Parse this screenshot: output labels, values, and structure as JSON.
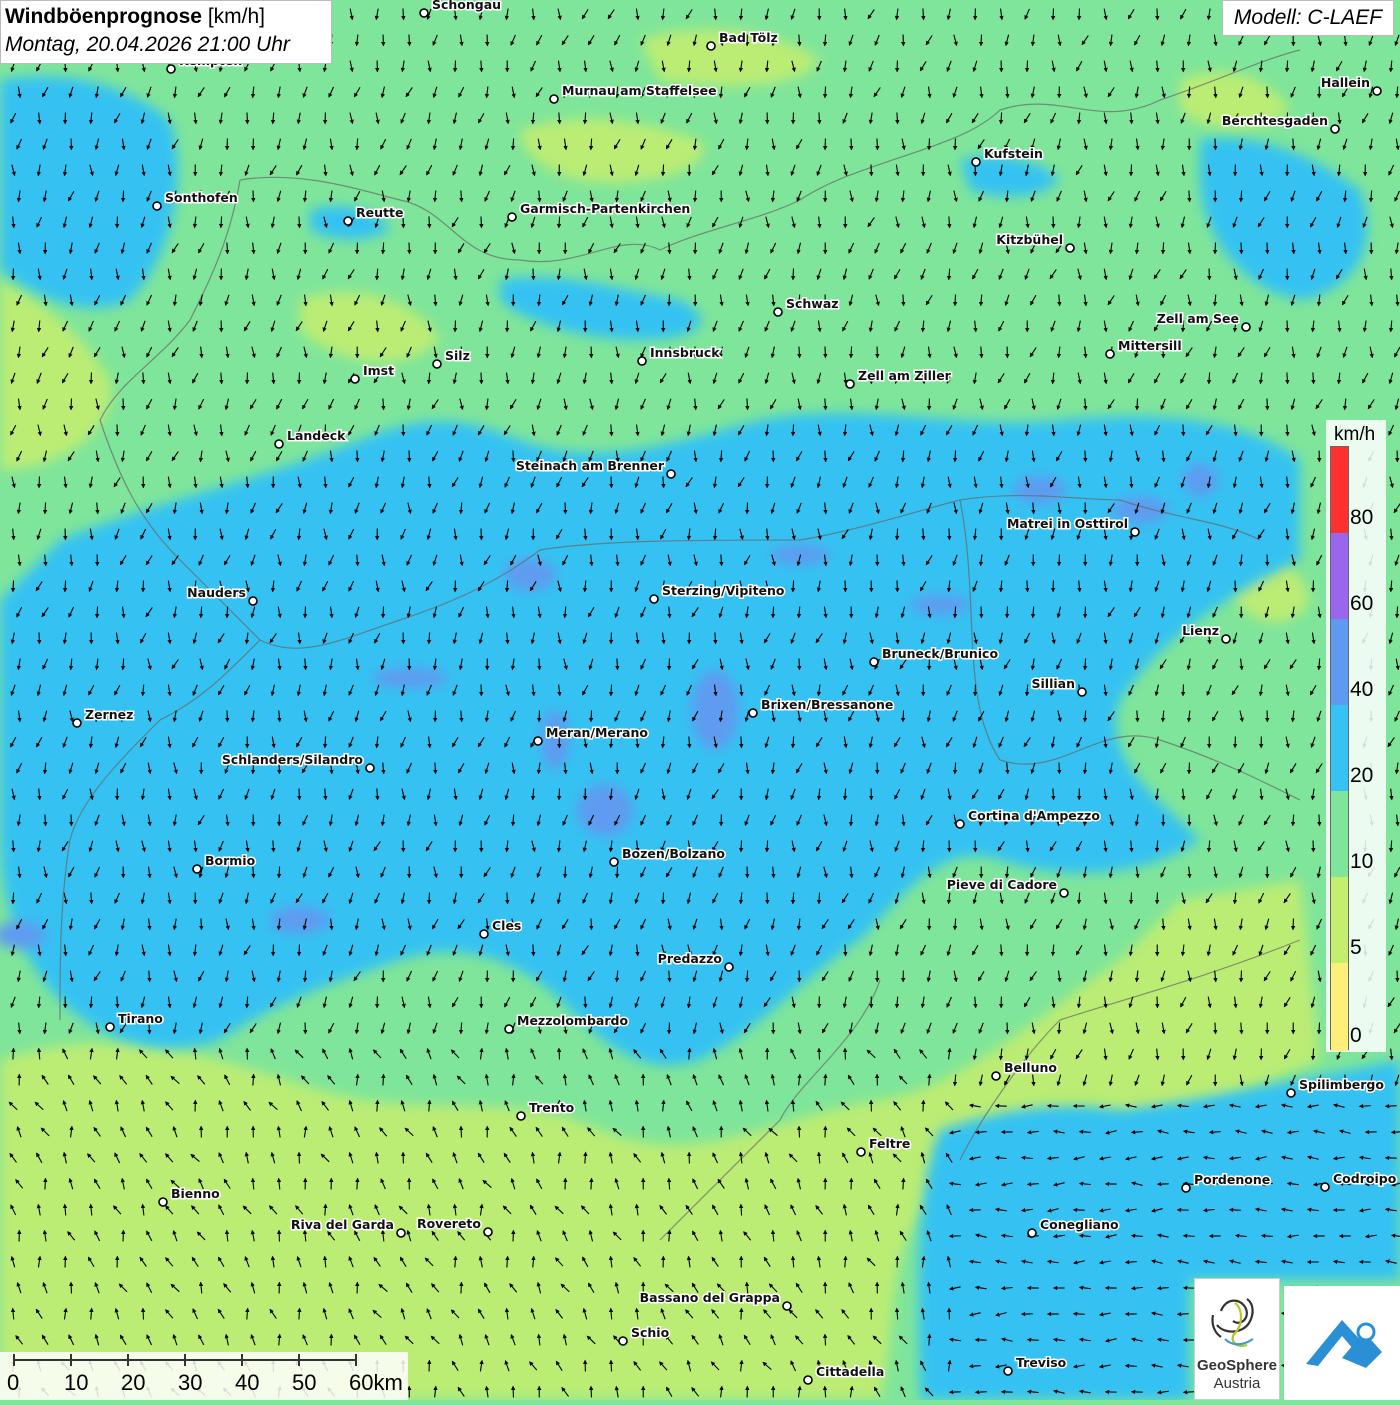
{
  "header": {
    "title_bold": "Windböenprognose",
    "title_unit": "[km/h]",
    "datetime": "Montag, 20.04.2026 21:00 Uhr",
    "model": "Modell: C-LAEF"
  },
  "legend": {
    "unit": "km/h",
    "ticks": [
      "80",
      "60",
      "40",
      "20",
      "10",
      "5",
      "0"
    ],
    "colors": [
      "#ff3030",
      "#9b66ee",
      "#5e9bf0",
      "#36c2f2",
      "#7fe59a",
      "#c6ee6e",
      "#fcf07a"
    ]
  },
  "scale": {
    "ticks": [
      "0",
      "10",
      "20",
      "30",
      "40",
      "50",
      "60km"
    ]
  },
  "logos": {
    "geosphere_line1": "GeoSphere",
    "geosphere_line2": "Austria",
    "geosphere_icon": "geosphere-swirl-icon",
    "app_icon": "mountain-cloud-icon"
  },
  "cities": [
    {
      "name": "Schongau",
      "side": "right"
    },
    {
      "name": "Bad Tölz",
      "side": "right"
    },
    {
      "name": "Kempten",
      "side": "right"
    },
    {
      "name": "Murnau am Staffelsee",
      "side": "right"
    },
    {
      "name": "Hallein",
      "side": "left"
    },
    {
      "name": "Berchtesgaden",
      "side": "left"
    },
    {
      "name": "Kufstein",
      "side": "right"
    },
    {
      "name": "Sonthofen",
      "side": "right"
    },
    {
      "name": "Reutte",
      "side": "right"
    },
    {
      "name": "Garmisch-Partenkirchen",
      "side": "right"
    },
    {
      "name": "Kitzbühel",
      "side": "left"
    },
    {
      "name": "Schwaz",
      "side": "right"
    },
    {
      "name": "Zell am See",
      "side": "left"
    },
    {
      "name": "Innsbruck",
      "side": "right"
    },
    {
      "name": "Mittersill",
      "side": "right"
    },
    {
      "name": "Silz",
      "side": "right"
    },
    {
      "name": "Imst",
      "side": "right"
    },
    {
      "name": "Zell am Ziller",
      "side": "right"
    },
    {
      "name": "Landeck",
      "side": "right"
    },
    {
      "name": "Steinach am Brenner",
      "side": "left"
    },
    {
      "name": "Matrei in Osttirol",
      "side": "left"
    },
    {
      "name": "Nauders",
      "side": "left"
    },
    {
      "name": "Sterzing/Vipiteno",
      "side": "right"
    },
    {
      "name": "Lienz",
      "side": "left"
    },
    {
      "name": "Bruneck/Brunico",
      "side": "right"
    },
    {
      "name": "Sillian",
      "side": "left"
    },
    {
      "name": "Zernez",
      "side": "right"
    },
    {
      "name": "Brixen/Bressanone",
      "side": "right"
    },
    {
      "name": "Meran/Merano",
      "side": "right"
    },
    {
      "name": "Schlanders/Silandro",
      "side": "left"
    },
    {
      "name": "Cortina d'Ampezzo",
      "side": "right"
    },
    {
      "name": "Bozen/Bolzano",
      "side": "right"
    },
    {
      "name": "Bormio",
      "side": "right"
    },
    {
      "name": "Pieve di Cadore",
      "side": "left"
    },
    {
      "name": "Cles",
      "side": "right"
    },
    {
      "name": "Predazzo",
      "side": "left"
    },
    {
      "name": "Tirano",
      "side": "right"
    },
    {
      "name": "Mezzolombardo",
      "side": "right"
    },
    {
      "name": "Belluno",
      "side": "right"
    },
    {
      "name": "Spilimbergo",
      "side": "right"
    },
    {
      "name": "Trento",
      "side": "right"
    },
    {
      "name": "Feltre",
      "side": "right"
    },
    {
      "name": "Pordenone",
      "side": "right"
    },
    {
      "name": "Codroipo",
      "side": "right"
    },
    {
      "name": "Bienno",
      "side": "right"
    },
    {
      "name": "Riva del Garda",
      "side": "left"
    },
    {
      "name": "Rovereto",
      "side": "left"
    },
    {
      "name": "Conegliano",
      "side": "right"
    },
    {
      "name": "Bassano del Grappa",
      "side": "left"
    },
    {
      "name": "Schio",
      "side": "right"
    },
    {
      "name": "Treviso",
      "side": "right"
    },
    {
      "name": "Cittadella",
      "side": "right"
    }
  ]
}
